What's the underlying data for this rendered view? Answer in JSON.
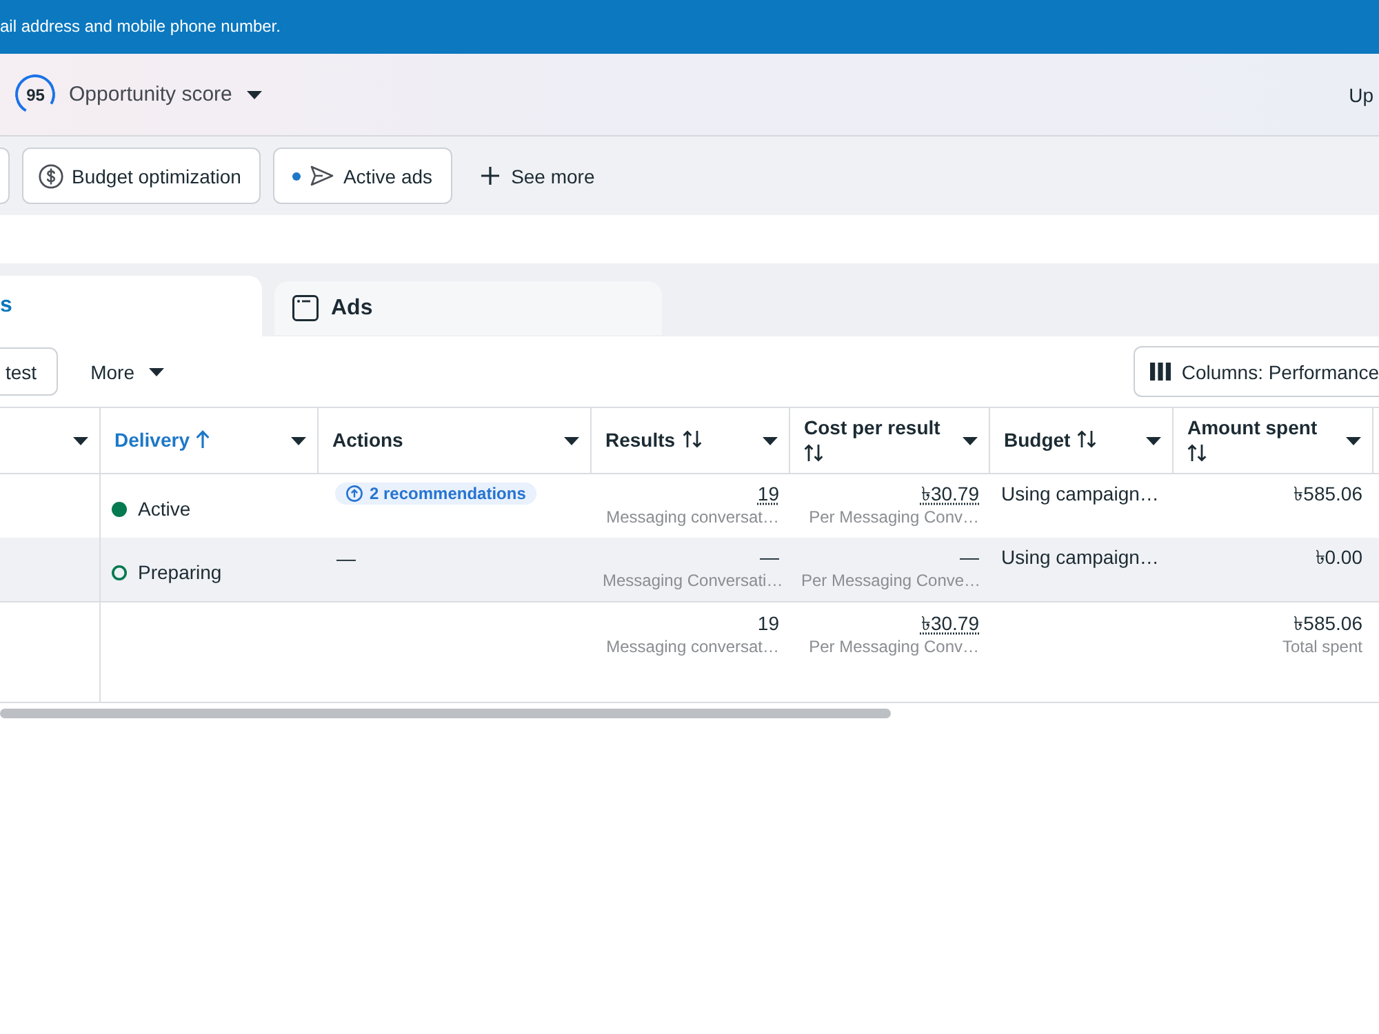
{
  "banner": {
    "text": "ail address and mobile phone number."
  },
  "score_bar": {
    "score": "95",
    "label": "Opportunity score",
    "status": "Up"
  },
  "filter_chips": [
    {
      "kind": "clipped"
    },
    {
      "kind": "budget",
      "indicator": false,
      "label": "Budget optimization"
    },
    {
      "kind": "delivery",
      "indicator": true,
      "label": "Active ads"
    },
    {
      "kind": "add",
      "label": "See more"
    }
  ],
  "tabs": [
    {
      "label": "s",
      "selected": true
    },
    {
      "label": "Ads",
      "selected": false
    }
  ],
  "toolbar": {
    "left": [
      {
        "kind": "outlined",
        "label": "test"
      },
      {
        "kind": "menu",
        "label": "More"
      }
    ],
    "columns_button": {
      "label": "Columns: Performance"
    }
  },
  "table": {
    "columns": [
      {
        "label": "Delivery",
        "sortable": true,
        "sorted": true
      },
      {
        "label": "Actions",
        "sortable": false,
        "sorted": false
      },
      {
        "label": "Results",
        "sortable": true,
        "sorted": false
      },
      {
        "label": "Cost per result",
        "sortable": true,
        "sorted": false
      },
      {
        "label": "Budget",
        "sortable": true,
        "sorted": false
      },
      {
        "label": "Amount spent",
        "sortable": true,
        "sorted": false
      }
    ],
    "rows": [
      {
        "hovered": false,
        "delivery": {
          "kind": "active",
          "text": "Active"
        },
        "actions": {
          "kind": "recommendations",
          "text": "2 recommendations"
        },
        "results": {
          "value": "19",
          "underlined": true,
          "detail": "Messaging conversat…"
        },
        "cost_per_result": {
          "value": "৳30.79",
          "underlined": true,
          "detail": "Per Messaging Conv…"
        },
        "budget": "Using campaign…",
        "amount_spent": "৳585.06"
      },
      {
        "hovered": true,
        "delivery": {
          "kind": "preparing",
          "text": "Preparing"
        },
        "actions": {
          "kind": "empty",
          "text": "—"
        },
        "results": {
          "value": "—",
          "underlined": false,
          "detail": "Messaging Conversati…"
        },
        "cost_per_result": {
          "value": "—",
          "underlined": false,
          "detail": "Per Messaging Conve…"
        },
        "budget": "Using campaign…",
        "amount_spent": "৳0.00"
      }
    ],
    "summary": {
      "results": {
        "value": "19",
        "underlined": false,
        "detail": "Messaging conversat…"
      },
      "cost_per_result": {
        "value": "৳30.79",
        "underlined": true,
        "detail": "Per Messaging Conv…"
      },
      "amount_spent": {
        "value": "৳585.06",
        "underlined": false,
        "detail": "Total spent"
      }
    }
  }
}
